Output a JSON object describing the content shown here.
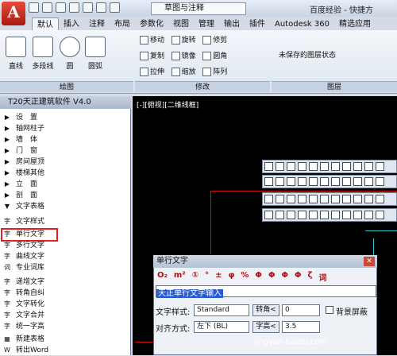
{
  "titlebar": {
    "app_letter": "A",
    "workspace": "草图与注释",
    "title": "百度经验 - 快捷方"
  },
  "tabs": [
    "默认",
    "插入",
    "注释",
    "布局",
    "参数化",
    "视图",
    "管理",
    "输出",
    "插件",
    "Autodesk 360",
    "精选应用"
  ],
  "ribbon": {
    "draw_buttons": [
      "直线",
      "多段线",
      "圆",
      "圆弧"
    ],
    "modify_rows": [
      [
        "移动",
        "旋转",
        "修剪"
      ],
      [
        "复制",
        "镜像",
        "圆角"
      ],
      [
        "拉伸",
        "缩放",
        "阵列"
      ]
    ],
    "layer_state": "未保存的图层状态",
    "panels": {
      "draw": "绘图",
      "modify": "修改",
      "layers": "图层"
    }
  },
  "side_panel": {
    "title": "T20天正建筑软件 V4.0",
    "groups": [
      "设　置",
      "轴网柱子",
      "墙　体",
      "门　窗",
      "房间屋顶",
      "楼梯其他",
      "立　面",
      "剖　面",
      "文字表格"
    ],
    "items": [
      "文字样式",
      "单行文字",
      "多行文字",
      "曲线文字",
      "专业词库",
      "递增文字",
      "转角自纠",
      "文字转化",
      "文字合并",
      "统一字高",
      "新建表格",
      "转出Word"
    ]
  },
  "viewport": {
    "label": "[-][俯视][二维线框]"
  },
  "dialog": {
    "title": "单行文字",
    "symbols": [
      "O₂",
      "m²",
      "①",
      "°",
      "±",
      "φ",
      "%",
      "Φ",
      "Φ",
      "Φ",
      "Φ",
      "ζ",
      "词"
    ],
    "text_value": "天正单行文字输入",
    "style_label": "文字样式:",
    "style_value": "Standard",
    "angle_button": "转角<",
    "angle_value": "0",
    "bg_mask": "背景屏蔽",
    "align_label": "对齐方式:",
    "align_value": "左下 (BL)",
    "height_button": "字高<",
    "height_value": "3.5"
  },
  "watermark": "jingyan.baidu.com",
  "colors": {
    "accent": "#2a5bd2",
    "highlight": "#e02020"
  }
}
